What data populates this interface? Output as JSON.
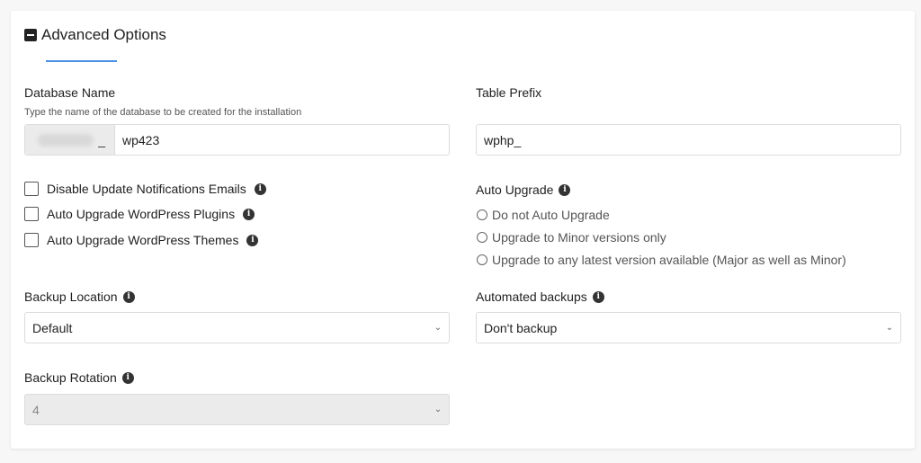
{
  "section": {
    "title": "Advanced Options",
    "toggle_icon": "minus-square-icon"
  },
  "database": {
    "label": "Database Name",
    "hint": "Type the name of the database to be created for the installation",
    "prefix_suffix": "_",
    "value": "wp423"
  },
  "table_prefix": {
    "label": "Table Prefix",
    "value": "wphp_"
  },
  "checkboxes": [
    {
      "label": "Disable Update Notifications Emails",
      "checked": false
    },
    {
      "label": "Auto Upgrade WordPress Plugins",
      "checked": false
    },
    {
      "label": "Auto Upgrade WordPress Themes",
      "checked": false
    }
  ],
  "auto_upgrade": {
    "label": "Auto Upgrade",
    "options": [
      "Do not Auto Upgrade",
      "Upgrade to Minor versions only",
      "Upgrade to any latest version available (Major as well as Minor)"
    ]
  },
  "backup_location": {
    "label": "Backup Location",
    "value": "Default"
  },
  "automated_backups": {
    "label": "Automated backups",
    "value": "Don't backup"
  },
  "backup_rotation": {
    "label": "Backup Rotation",
    "value": "4"
  },
  "icons": {
    "info": "i",
    "chevron": "⌄"
  },
  "colors": {
    "accent": "#4a90e2",
    "panel_bg": "#ffffff",
    "page_bg": "#f7f7f8"
  }
}
